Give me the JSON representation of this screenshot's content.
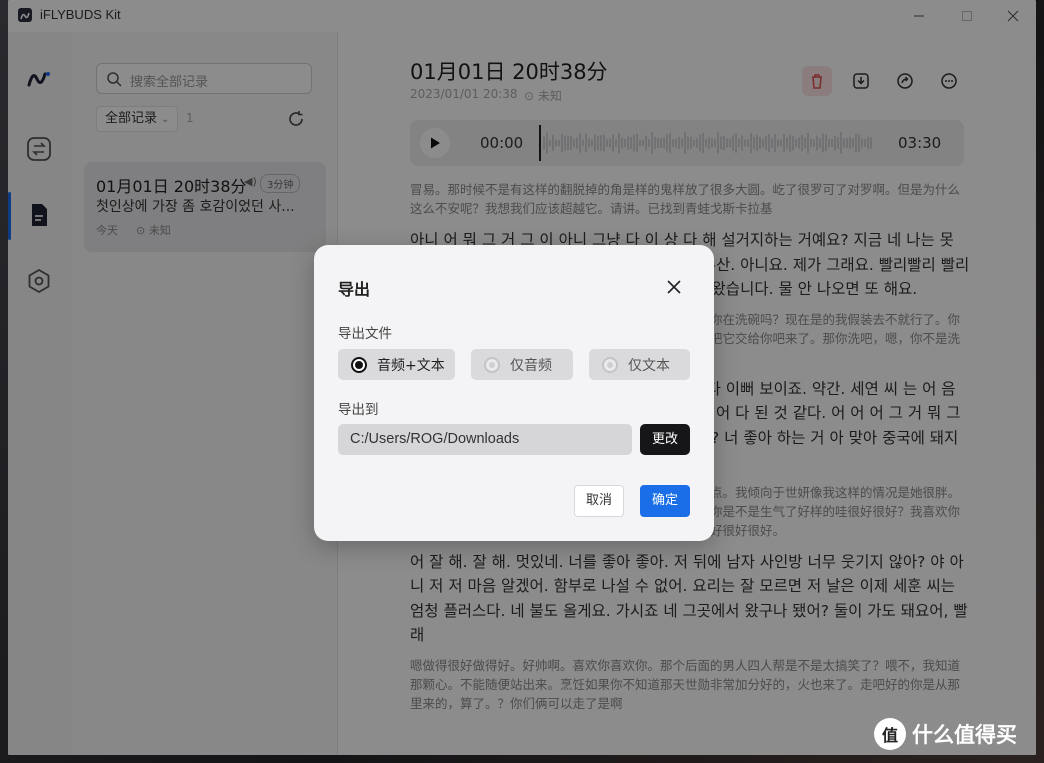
{
  "window": {
    "title": "iFLYBUDS Kit"
  },
  "list": {
    "search_placeholder": "搜索全部记录",
    "filter_label": "全部记录",
    "count": "1",
    "card": {
      "title": "01月01日 20时38分",
      "duration": "3分钟",
      "snippet": "첫인상에 가장 좀 호감이었던 사...",
      "date": "今天",
      "location": "未知"
    }
  },
  "detail": {
    "title": "01月01日 20时38分",
    "timestamp": "2023/01/01 20:38",
    "location": "未知",
    "player": {
      "current": "00:00",
      "total": "03:30",
      "progress": 0
    },
    "paragraphs": [
      {
        "lang": "zh",
        "text": "冒易。那时候不是有这样的翻脱掉的角是样的鬼样放了很多大圆。屹了很罗可了对罗啊。但是为什么这么不安呢？我想我们应该超越它。请讲。已找到青蛙戈斯卡拉基"
      },
      {
        "lang": "ko",
        "text": "아니 어 뭐 그 거 그 이 아니 그냥 다 이 상 다 해 설거지하는 거예요? 지금 네 나는 못 해요 아 그러니까 이 상 다 좀 해 해서 어어어 부산. 아니요. 제가 그래요. 빨리빨리 빨리 해서 어 어 근데 그 거 해 봐 해 봐서 빨리 빨리 왔습니다. 물 안 나오면 또 해요."
      },
      {
        "lang": "zh",
        "text": "对。你在做什么？你在洗碗吗？我在做，在这里呢啊。你在洗碗吗？现在是的我假装去不就行了。你知道吗，我没做完了没有洗完呢。我会尽快做完的那我把它交给你吧来了。那你洗吧，嗯，你不是洗了啊，那是你的事。是啊，"
      },
      {
        "lang": "ko",
        "text": "네 그래 어 어 예쁘다 예뻐 아 그 거 머리 해서 다 이뻐 보이죠. 약간. 세연 씨 는 어 음 너무 귀여워 귀엽다 했어 어 나는 예 뚱뚱해. 아 어 다 된 것 같다. 어 어 어 그 거 뭐 그 거 좋아 좋아 좋아 나일까 나이스 와 좋아. 좋아? 너 좋아 하는 거 아 맞아 중국에 돼지고기 육 맛있어 네 구웠어요 좋아 좋아 좋아."
      },
      {
        "lang": "zh",
        "text": "是的，我觉得很漂亮。很漂亮呢，我觉得很漂亮。有一点。我倾向于世妍像我这样的情况是她很胖。啊驰好像都好了。没错？驰。饭做得好。啊，隐隐约约你是不是生气了好样的哇很好很好？我喜欢你哇是汉族？这里是生存肉肉烤好了吗。是的，我烤了很好很好很好。"
      },
      {
        "lang": "ko",
        "text": "어 잘 해. 잘 해. 멋있네. 너를 좋아 좋아. 저 뒤에 남자 사인방 너무 웃기지 않아? 야 아니 저 저 마음 알겠어. 함부로 나설 수 없어. 요리는 잘 모르면 저 날은 이제 세훈 씨는 엄청 플러스다. 네 불도 올게요. 가시죠 네 그곳에서 왔구나 됐어? 둘이 가도 돼요어, 빨래"
      },
      {
        "lang": "zh",
        "text": "嗯做得很好做得好。好帅啊。喜欢你喜欢你。那个后面的男人四人帮是不是太搞笑了？喂不，我知道那颗心。不能随便站出来。烹饪如果你不知道那天世勋非常加分好的，火也来了。走吧好的你是从那里来的，算了。？你们俩可以走了是啊"
      }
    ]
  },
  "dialog": {
    "title": "导出",
    "file_label": "导出文件",
    "options": [
      {
        "label": "音频+文本",
        "selected": true,
        "enabled": true
      },
      {
        "label": "仅音频",
        "selected": false,
        "enabled": false
      },
      {
        "label": "仅文本",
        "selected": false,
        "enabled": false
      }
    ],
    "dest_label": "导出到",
    "path": "C:/Users/ROG/Downloads",
    "change_label": "更改",
    "cancel_label": "取消",
    "ok_label": "确定"
  },
  "watermark": {
    "glyph": "值",
    "text": "什么值得买"
  },
  "colors": {
    "accent": "#1a6fe8",
    "danger_bg": "#fde4e4",
    "dark_button": "#161618"
  }
}
